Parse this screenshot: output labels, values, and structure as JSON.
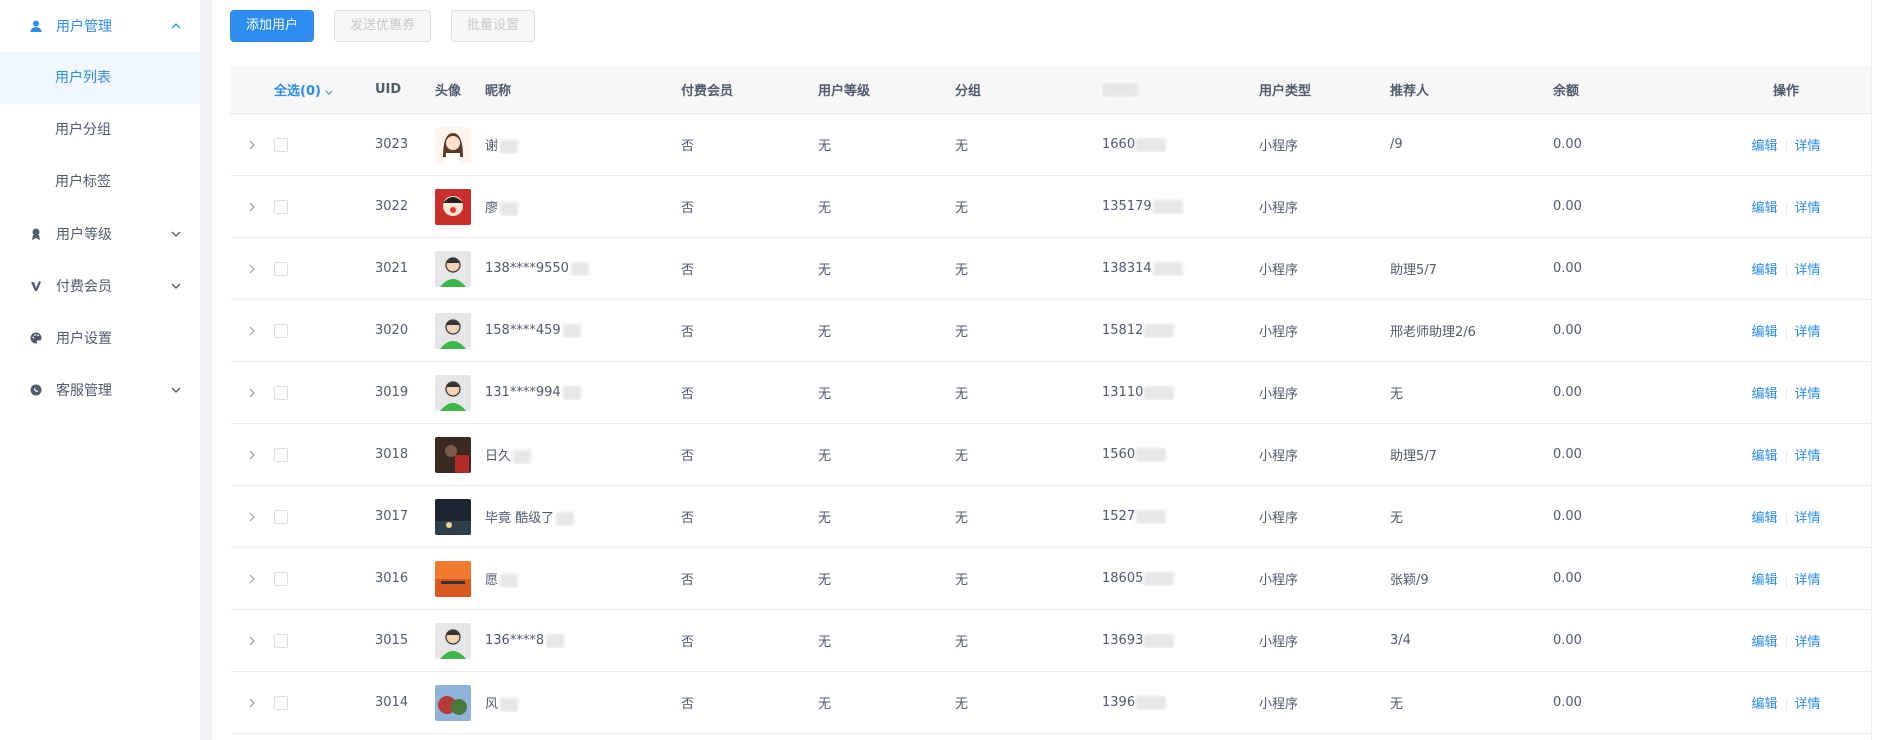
{
  "sidebar": {
    "groups": [
      {
        "label": "用户管理",
        "icon": "user-icon",
        "expanded": true,
        "items": [
          {
            "label": "用户列表",
            "active": true
          },
          {
            "label": "用户分组",
            "active": false
          },
          {
            "label": "用户标签",
            "active": false
          }
        ]
      },
      {
        "label": "用户等级",
        "icon": "rank-icon",
        "expanded": false
      },
      {
        "label": "付费会员",
        "icon": "vip-icon",
        "expanded": false
      },
      {
        "label": "用户设置",
        "icon": "palette-icon",
        "expanded": false
      },
      {
        "label": "客服管理",
        "icon": "chat-icon",
        "expanded": false
      }
    ]
  },
  "toolbar": {
    "add_user": "添加用户",
    "send_coupon": "发送优惠券",
    "batch_set": "批量设置"
  },
  "table": {
    "select_all": "全选(0)",
    "headers": {
      "uid": "UID",
      "avatar": "头像",
      "nickname": "昵称",
      "paid": "付费会员",
      "level": "用户等级",
      "group": "分组",
      "phone": "",
      "type": "用户类型",
      "referrer": "推荐人",
      "balance": "余额",
      "ops": "操作"
    },
    "ops": {
      "edit": "编辑",
      "detail": "详情"
    },
    "rows": [
      {
        "uid": "3023",
        "nickname": "谢",
        "paid": "否",
        "level": "无",
        "group": "无",
        "phone": "1660",
        "type": "小程序",
        "referrer": "/9",
        "balance": "0.00",
        "avatar": "girl"
      },
      {
        "uid": "3022",
        "nickname": "廖",
        "paid": "否",
        "level": "无",
        "group": "无",
        "phone": "135179",
        "type": "小程序",
        "referrer": "",
        "balance": "0.00",
        "avatar": "cartoon"
      },
      {
        "uid": "3021",
        "nickname": "138****9550",
        "paid": "否",
        "level": "无",
        "group": "无",
        "phone": "138314",
        "type": "小程序",
        "referrer": "助理5/7",
        "balance": "0.00",
        "avatar": "default"
      },
      {
        "uid": "3020",
        "nickname": "158****459",
        "paid": "否",
        "level": "无",
        "group": "无",
        "phone": "15812",
        "type": "小程序",
        "referrer": "邢老师助理2/6",
        "balance": "0.00",
        "avatar": "default"
      },
      {
        "uid": "3019",
        "nickname": "131****994",
        "paid": "否",
        "level": "无",
        "group": "无",
        "phone": "13110",
        "type": "小程序",
        "referrer": "无",
        "balance": "0.00",
        "avatar": "default"
      },
      {
        "uid": "3018",
        "nickname": "日久",
        "paid": "否",
        "level": "无",
        "group": "无",
        "phone": "1560",
        "type": "小程序",
        "referrer": "助理5/7",
        "balance": "0.00",
        "avatar": "photo1"
      },
      {
        "uid": "3017",
        "nickname": "毕竟 酷级了",
        "paid": "否",
        "level": "无",
        "group": "无",
        "phone": "1527",
        "type": "小程序",
        "referrer": "无",
        "balance": "0.00",
        "avatar": "photo2"
      },
      {
        "uid": "3016",
        "nickname": "愿",
        "paid": "否",
        "level": "无",
        "group": "无",
        "phone": "18605",
        "type": "小程序",
        "referrer": "张颖/9",
        "balance": "0.00",
        "avatar": "sunset"
      },
      {
        "uid": "3015",
        "nickname": "136****8",
        "paid": "否",
        "level": "无",
        "group": "无",
        "phone": "13693",
        "type": "小程序",
        "referrer": "3/4",
        "balance": "0.00",
        "avatar": "default"
      },
      {
        "uid": "3014",
        "nickname": "风",
        "paid": "否",
        "level": "无",
        "group": "无",
        "phone": "1396",
        "type": "小程序",
        "referrer": "无",
        "balance": "0.00",
        "avatar": "photo3"
      }
    ]
  }
}
